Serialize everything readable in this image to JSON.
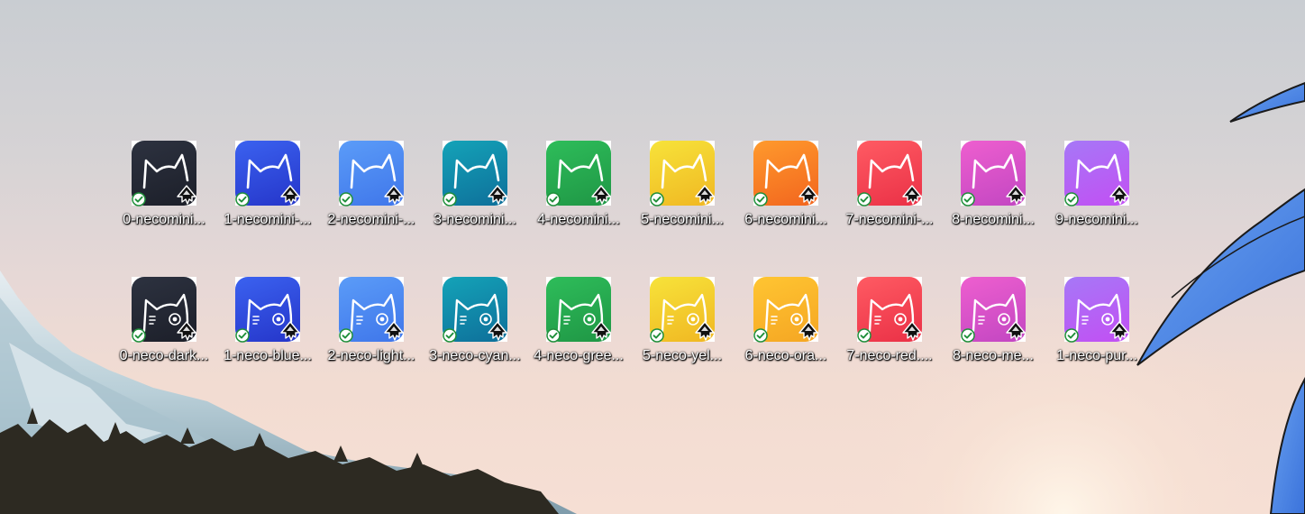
{
  "desktop": {
    "icons": [
      {
        "name": "0-necomini...",
        "color_top": "#2d3240",
        "color_bottom": "#1c1f29",
        "style": "mini"
      },
      {
        "name": "1-necomini-...",
        "color_top": "#3b62f0",
        "color_bottom": "#2535c9",
        "style": "mini"
      },
      {
        "name": "2-necomini-...",
        "color_top": "#5b9cf8",
        "color_bottom": "#3f76ea",
        "style": "mini"
      },
      {
        "name": "3-necomini...",
        "color_top": "#14a3b8",
        "color_bottom": "#0e6f9a",
        "style": "mini"
      },
      {
        "name": "4-necomini...",
        "color_top": "#2ebd5a",
        "color_bottom": "#1f9645",
        "style": "mini"
      },
      {
        "name": "5-necomini...",
        "color_top": "#f7e33a",
        "color_bottom": "#f0b722",
        "style": "mini"
      },
      {
        "name": "6-necomini...",
        "color_top": "#ff9a2d",
        "color_bottom": "#f2651e",
        "style": "mini"
      },
      {
        "name": "7-necomini-...",
        "color_top": "#ff5b63",
        "color_bottom": "#ea3046",
        "style": "mini"
      },
      {
        "name": "8-necomini...",
        "color_top": "#ee5fcf",
        "color_bottom": "#c246c2",
        "style": "mini"
      },
      {
        "name": "9-necomini...",
        "color_top": "#a678f7",
        "color_bottom": "#c24ff3",
        "style": "mini"
      },
      {
        "name": "0-neco-dark...",
        "color_top": "#2d3240",
        "color_bottom": "#1c1f29",
        "style": "full"
      },
      {
        "name": "1-neco-blue...",
        "color_top": "#3b62f0",
        "color_bottom": "#2535c9",
        "style": "full"
      },
      {
        "name": "2-neco-light...",
        "color_top": "#5b9cf8",
        "color_bottom": "#3f76ea",
        "style": "full"
      },
      {
        "name": "3-neco-cyan...",
        "color_top": "#14a3b8",
        "color_bottom": "#0e6f9a",
        "style": "full"
      },
      {
        "name": "4-neco-gree...",
        "color_top": "#2ebd5a",
        "color_bottom": "#1f9645",
        "style": "full"
      },
      {
        "name": "5-neco-yel...",
        "color_top": "#f7e33a",
        "color_bottom": "#f0b722",
        "style": "full"
      },
      {
        "name": "6-neco-ora...",
        "color_top": "#ffc532",
        "color_bottom": "#f5a623",
        "style": "full"
      },
      {
        "name": "7-neco-red....",
        "color_top": "#ff5b63",
        "color_bottom": "#ea3046",
        "style": "full"
      },
      {
        "name": "8-neco-me...",
        "color_top": "#ee5fcf",
        "color_bottom": "#c246c2",
        "style": "full"
      },
      {
        "name": "1-neco-pur...",
        "color_top": "#a678f7",
        "color_bottom": "#c24ff3",
        "style": "full"
      }
    ]
  },
  "overlays": {
    "sync_status_icon": "green-checkmark-icon",
    "app_badge_icon": "inkscape-icon"
  }
}
